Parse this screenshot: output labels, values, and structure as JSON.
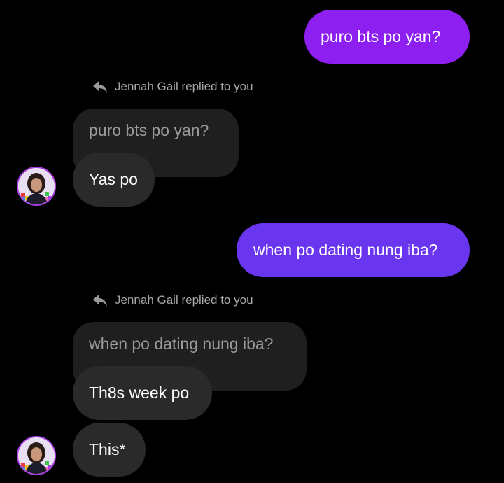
{
  "messages": [
    {
      "type": "outgoing",
      "text": "puro bts po yan?"
    },
    {
      "type": "incoming_reply",
      "reply_label": "Jennah Gail replied to you",
      "quoted": "puro bts po yan?",
      "texts": [
        "Yas po"
      ]
    },
    {
      "type": "outgoing",
      "text": "when po dating nung iba?"
    },
    {
      "type": "incoming_reply",
      "reply_label": "Jennah Gail replied to you",
      "quoted": "when po dating nung iba?",
      "texts": [
        "Th8s week po",
        "This*"
      ]
    }
  ],
  "colors": {
    "background": "#000000",
    "outgoing_bubble_1": "#8d1ff0",
    "outgoing_bubble_2": "#6a35ee",
    "incoming_bubble": "#2a2a2a",
    "quoted_bubble": "#1f1f1f",
    "reply_label": "#a8a8a8"
  },
  "icons": {
    "reply": "reply-arrow-icon",
    "avatar": "profile-photo"
  }
}
